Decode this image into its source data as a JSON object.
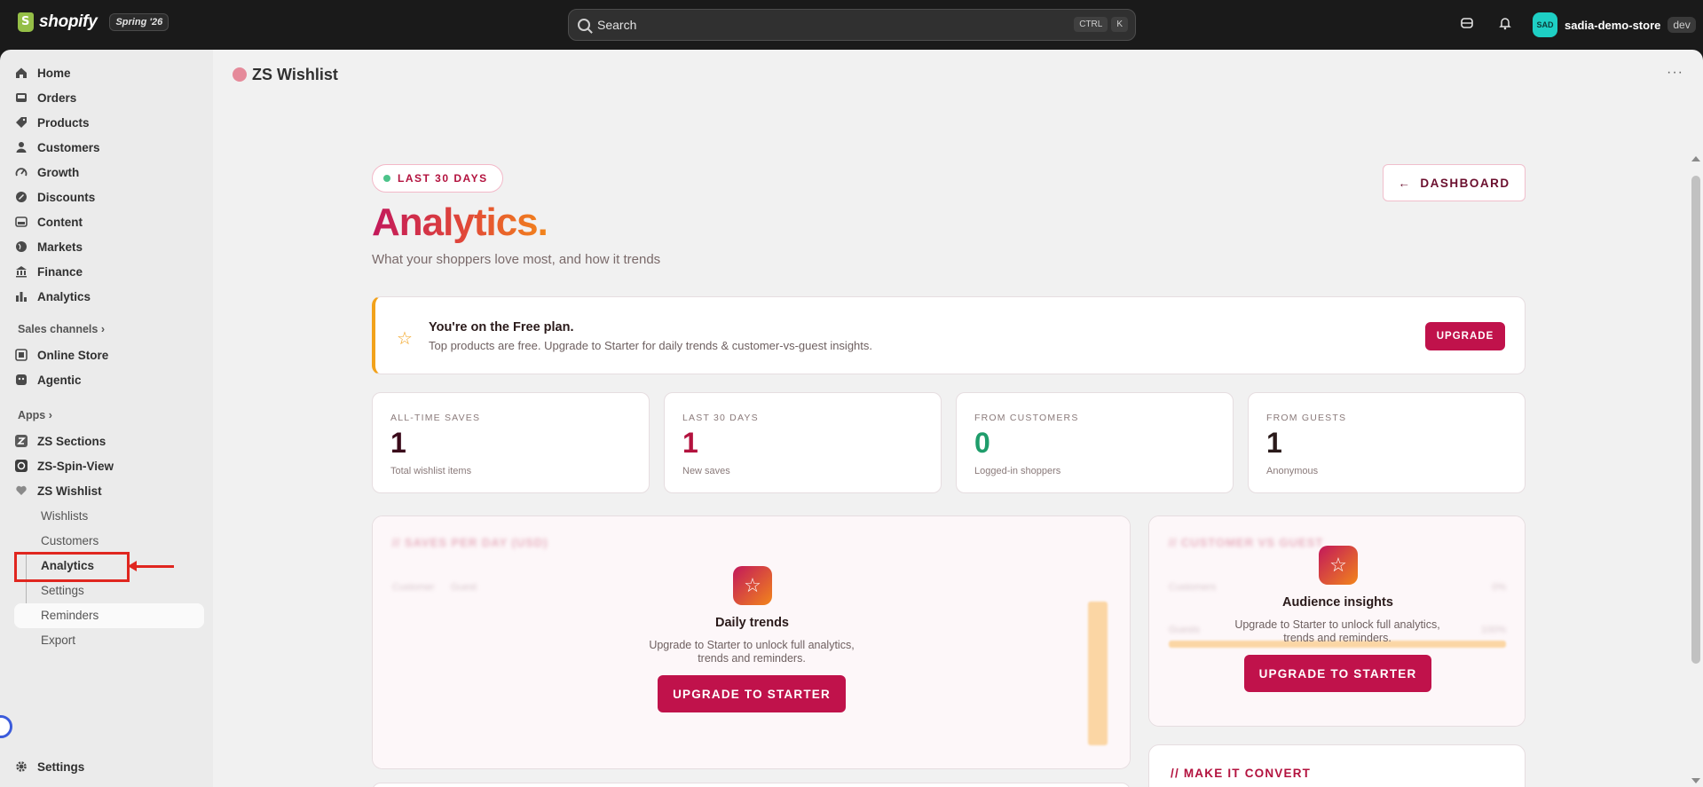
{
  "topbar": {
    "logo_text": "shopify",
    "edition": "Spring '26",
    "search_placeholder": "Search",
    "shortcut_key1": "CTRL",
    "shortcut_key2": "K",
    "store_initials": "SAD",
    "store_name": "sadia-demo-store",
    "store_env": "dev"
  },
  "sidebar": {
    "items": [
      {
        "label": "Home",
        "icon": "home-icon"
      },
      {
        "label": "Orders",
        "icon": "inbox-icon"
      },
      {
        "label": "Products",
        "icon": "tag-icon"
      },
      {
        "label": "Customers",
        "icon": "person-icon"
      },
      {
        "label": "Growth",
        "icon": "gauge-icon"
      },
      {
        "label": "Discounts",
        "icon": "discount-icon"
      },
      {
        "label": "Content",
        "icon": "content-icon"
      },
      {
        "label": "Markets",
        "icon": "globe-icon"
      },
      {
        "label": "Finance",
        "icon": "bank-icon"
      },
      {
        "label": "Analytics",
        "icon": "bar-chart-icon"
      }
    ],
    "sales_channels_label": "Sales channels",
    "channels": [
      {
        "label": "Online Store",
        "icon": "store-icon"
      },
      {
        "label": "Agentic",
        "icon": "agent-icon"
      }
    ],
    "apps_label": "Apps",
    "apps": [
      {
        "label": "ZS Sections",
        "icon": "zs-sections-icon"
      },
      {
        "label": "ZS-Spin-View",
        "icon": "zs-spin-view-icon"
      },
      {
        "label": "ZS Wishlist",
        "icon": "zs-wishlist-icon"
      }
    ],
    "wishlist_sub": [
      "Wishlists",
      "Customers",
      "Analytics",
      "Settings",
      "Reminders",
      "Export"
    ],
    "settings_label": "Settings"
  },
  "app": {
    "title": "ZS Wishlist",
    "more_label": "···"
  },
  "page": {
    "badge": "LAST 30 DAYS",
    "dashboard_button": "DASHBOARD",
    "title": "Analytics.",
    "subtitle": "What your shoppers love most, and how it trends"
  },
  "plan": {
    "title": "You're on the Free plan.",
    "text": "Top products are free. Upgrade to Starter for daily trends & customer-vs-guest insights.",
    "button": "UPGRADE"
  },
  "stats": [
    {
      "label": "ALL-TIME SAVES",
      "value": "1",
      "sub": "Total wishlist items",
      "color": "#3a0a1a"
    },
    {
      "label": "LAST 30 DAYS",
      "value": "1",
      "sub": "New saves",
      "color": "#b3123e"
    },
    {
      "label": "FROM CUSTOMERS",
      "value": "0",
      "sub": "Logged-in shoppers",
      "color": "#1f9d6b"
    },
    {
      "label": "FROM GUESTS",
      "value": "1",
      "sub": "Anonymous",
      "color": "#2a1a1a"
    }
  ],
  "locked_daily": {
    "bg_title": "// SAVES PER DAY (USD)",
    "bg_legend": [
      "Customer",
      "Guest"
    ],
    "title": "Daily trends",
    "text": "Upgrade to Starter to unlock full analytics, trends and reminders.",
    "button": "UPGRADE TO STARTER"
  },
  "locked_audience": {
    "bg_title": "// CUSTOMER VS GUEST",
    "bg_rows": [
      {
        "label": "Customers",
        "value": "0%"
      },
      {
        "label": "Guests",
        "value": "100%"
      }
    ],
    "title": "Audience insights",
    "text": "Upgrade to Starter to unlock full analytics, trends and reminders.",
    "button": "UPGRADE TO STARTER"
  },
  "convert": {
    "title": "// MAKE IT CONVERT"
  }
}
